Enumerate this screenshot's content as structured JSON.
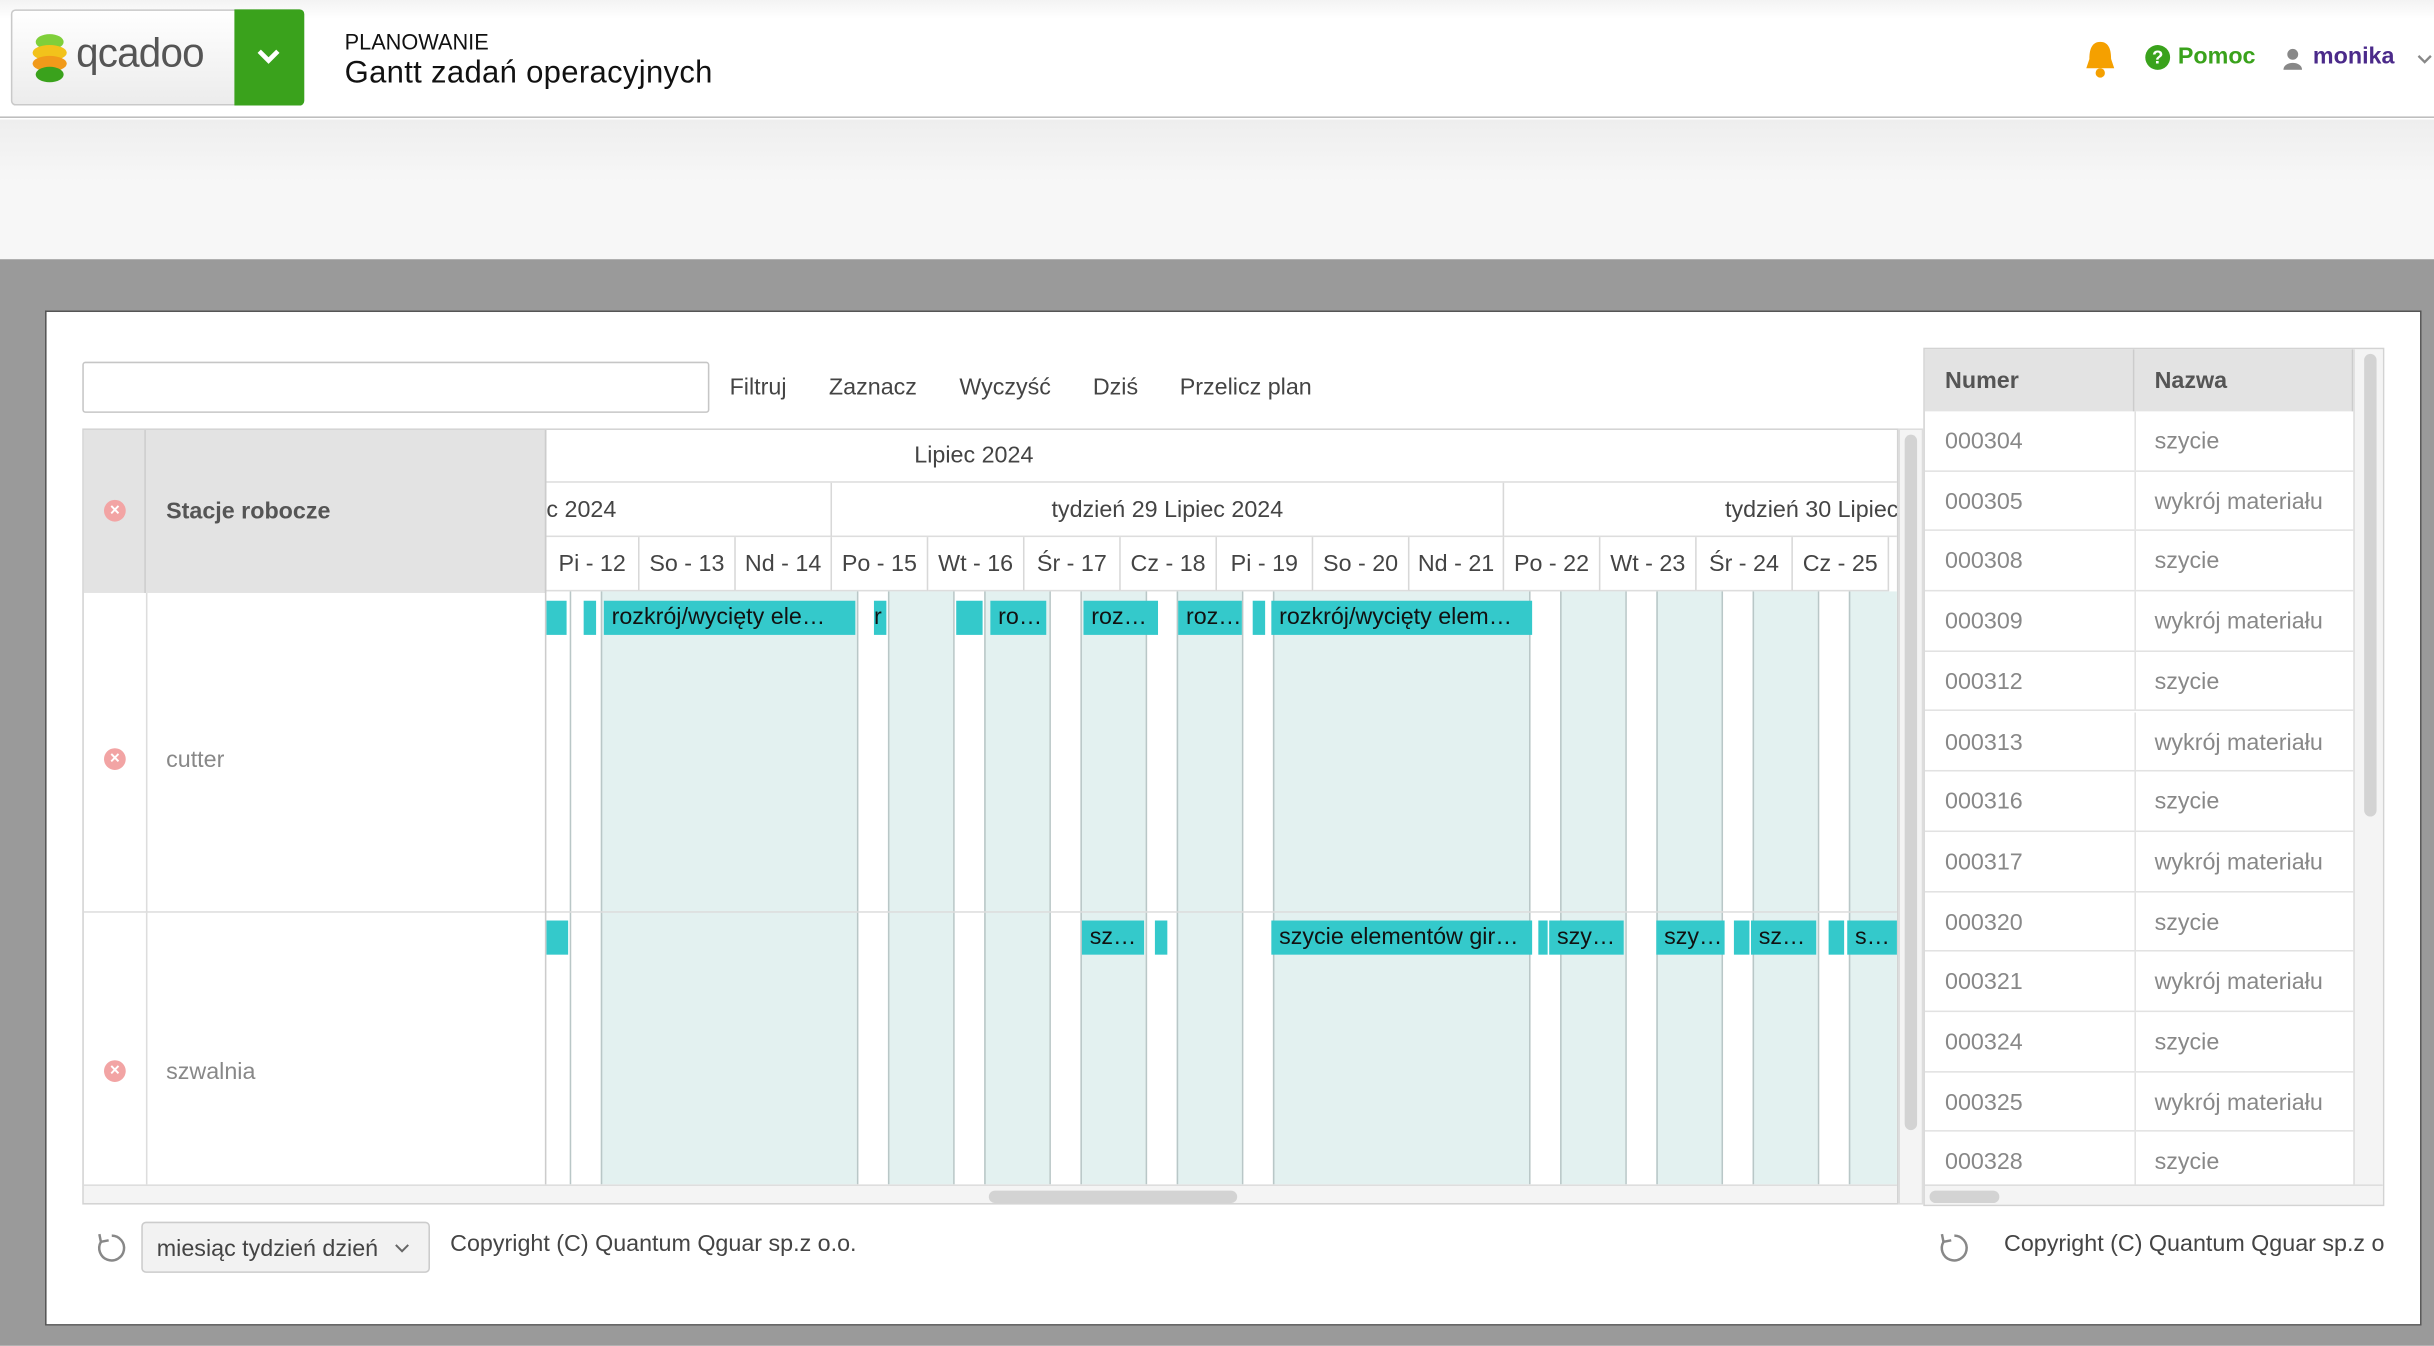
{
  "header": {
    "logo_text": "qcadoo",
    "section": "PLANOWANIE",
    "title": "Gantt zadań operacyjnych",
    "help": "Pomoc",
    "user": "monika"
  },
  "toolbar": {
    "search_value": "",
    "filter": "Filtruj",
    "select": "Zaznacz",
    "clear": "Wyczyść",
    "today": "Dziś",
    "recalc": "Przelicz plan"
  },
  "gantt": {
    "column_header": "Stacje robocze",
    "month": "Lipiec 2024",
    "weeks": [
      "c 2024",
      "tydzień 29 Lipiec 2024",
      "tydzień 30 Lipiec"
    ],
    "days": [
      "Pi - 12",
      "So - 13",
      "Nd - 14",
      "Po - 15",
      "Wt - 16",
      "Śr - 17",
      "Cz - 18",
      "Pi - 19",
      "So - 20",
      "Nd - 21",
      "Po - 22",
      "Wt - 23",
      "Śr - 24",
      "Cz - 25"
    ],
    "rows": [
      {
        "name": "cutter",
        "bars": [
          "",
          "",
          "rozkrój/wycięty ele…",
          "r",
          "",
          "ro…",
          "roz…",
          "roz…",
          "",
          "rozkrój/wycięty elem…"
        ]
      },
      {
        "name": "szwalnia",
        "bars": [
          "",
          "sz…",
          "",
          "szycie elementów gir…",
          "",
          "szy…",
          "szy…",
          "",
          "sz…",
          "",
          "s…"
        ]
      }
    ]
  },
  "orders": {
    "columns": [
      "Numer",
      "Nazwa"
    ],
    "rows": [
      [
        "000304",
        "szycie"
      ],
      [
        "000305",
        "wykrój materiału"
      ],
      [
        "000308",
        "szycie"
      ],
      [
        "000309",
        "wykrój materiału"
      ],
      [
        "000312",
        "szycie"
      ],
      [
        "000313",
        "wykrój materiału"
      ],
      [
        "000316",
        "szycie"
      ],
      [
        "000317",
        "wykrój materiału"
      ],
      [
        "000320",
        "szycie"
      ],
      [
        "000321",
        "wykrój materiału"
      ],
      [
        "000324",
        "szycie"
      ],
      [
        "000325",
        "wykrój materiału"
      ],
      [
        "000328",
        "szycie"
      ]
    ]
  },
  "footer": {
    "view_mode": "miesiąc tydzień dzień",
    "copyright_left": "Copyright (C) Quantum Qguar sp.z o.o.",
    "copyright_right": "Copyright (C) Quantum Qguar sp.z o"
  },
  "colors": {
    "brand_green": "#3aa21c",
    "bar": "#34c9cb",
    "shade": "#e3f1f0"
  }
}
